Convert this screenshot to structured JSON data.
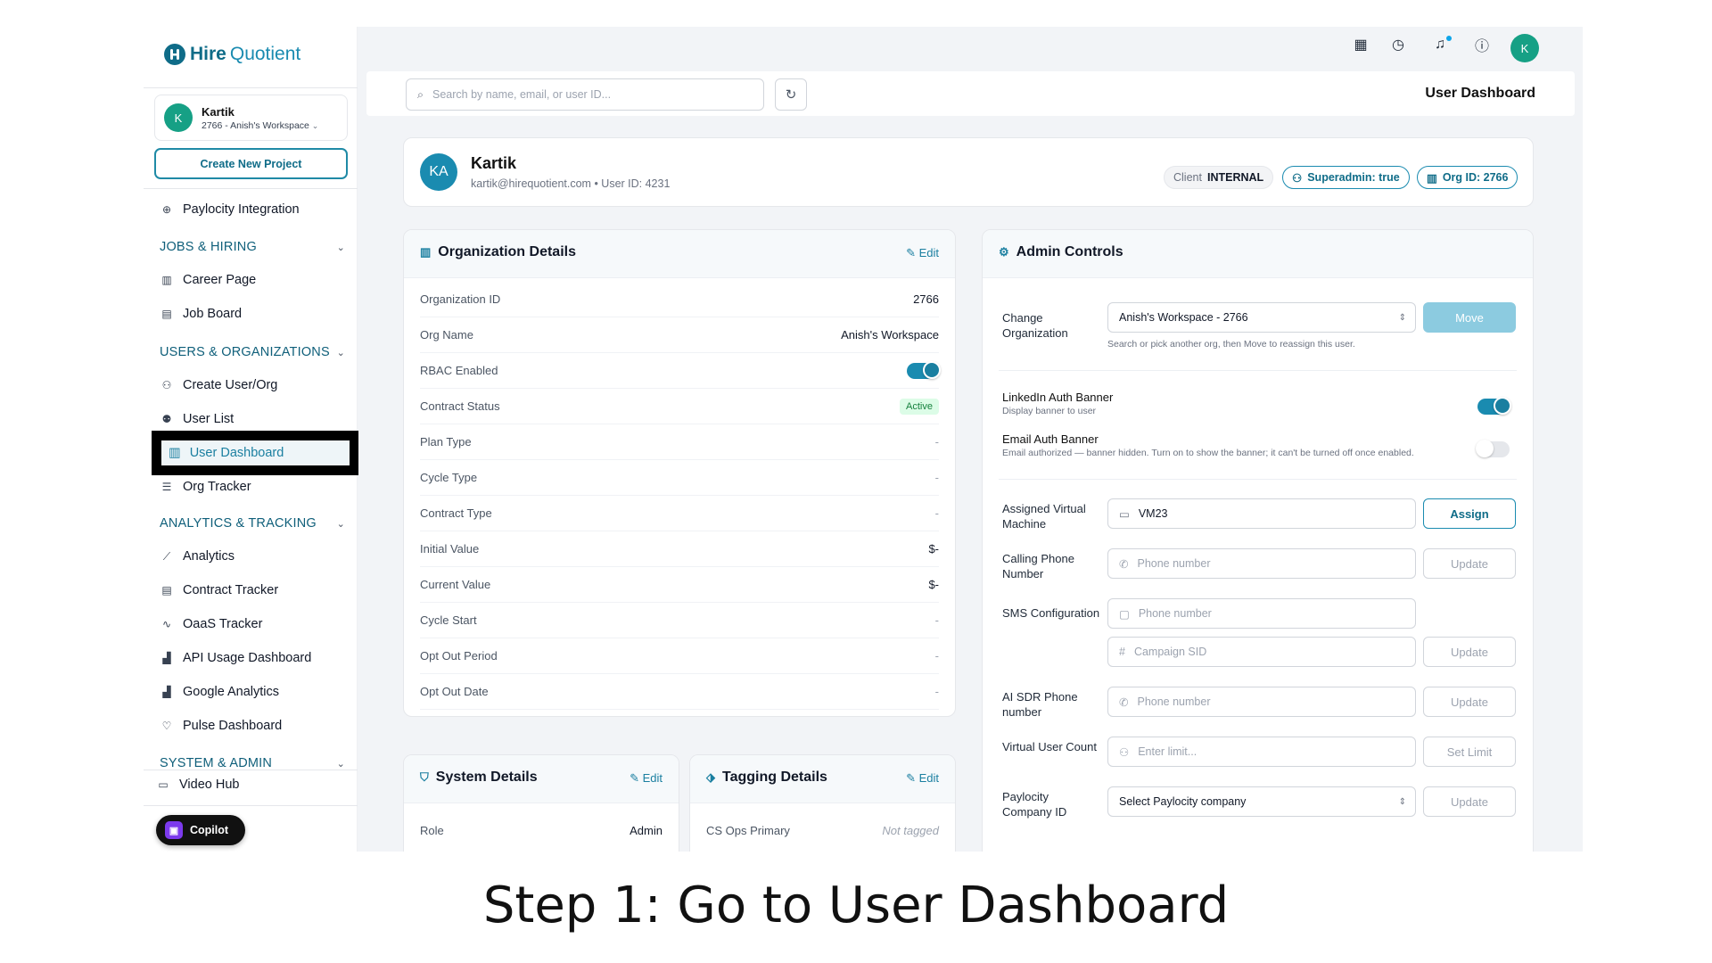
{
  "brand": {
    "name_a": "Hire",
    "name_b": "Quotient"
  },
  "account": {
    "initial": "K",
    "name": "Kartik",
    "workspace": "2766 - Anish's Workspace"
  },
  "sidebar": {
    "create_btn": "Create New Project",
    "top_item": "Paylocity Integration",
    "sections": [
      {
        "title": "JOBS & HIRING",
        "items": [
          "Career Page",
          "Job Board"
        ]
      },
      {
        "title": "USERS & ORGANIZATIONS",
        "items": [
          "Create User/Org",
          "User List",
          "User Dashboard",
          "Org Tracker"
        ]
      },
      {
        "title": "ANALYTICS & TRACKING",
        "items": [
          "Analytics",
          "Contract Tracker",
          "OaaS Tracker",
          "API Usage Dashboard",
          "Google Analytics",
          "Pulse Dashboard"
        ]
      },
      {
        "title": "SYSTEM & ADMIN",
        "items": []
      }
    ],
    "bottom_item": "Video Hub",
    "copilot": "Copilot"
  },
  "topbar": {
    "avatar": "K",
    "icons": [
      "calendar-icon",
      "calendar-clock-icon",
      "bell-icon",
      "help-icon"
    ]
  },
  "search": {
    "placeholder": "Search by name, email, or user ID..."
  },
  "page_title": "User Dashboard",
  "user": {
    "initials": "KA",
    "name": "Kartik",
    "subline": "kartik@hirequotient.com • User ID: 4231",
    "client_label": "Client",
    "client_value": "INTERNAL",
    "superadmin": "Superadmin: true",
    "org_id": "Org ID: 2766"
  },
  "org_details": {
    "title": "Organization Details",
    "edit": "Edit",
    "rows": [
      {
        "k": "Organization ID",
        "v": "2766"
      },
      {
        "k": "Org Name",
        "v": "Anish's Workspace"
      },
      {
        "k": "RBAC Enabled",
        "v": ""
      },
      {
        "k": "Contract Status",
        "v": "Active"
      },
      {
        "k": "Plan Type",
        "v": "-"
      },
      {
        "k": "Cycle Type",
        "v": "-"
      },
      {
        "k": "Contract Type",
        "v": "-"
      },
      {
        "k": "Initial Value",
        "v": "$-"
      },
      {
        "k": "Current Value",
        "v": "$-"
      },
      {
        "k": "Cycle Start",
        "v": "-"
      },
      {
        "k": "Opt Out Period",
        "v": "-"
      },
      {
        "k": "Opt Out Date",
        "v": "-"
      }
    ],
    "rbac_enabled": true
  },
  "system_details": {
    "title": "System Details",
    "edit": "Edit",
    "role_label": "Role",
    "role_value": "Admin"
  },
  "tagging_details": {
    "title": "Tagging Details",
    "edit": "Edit",
    "cs_label": "CS Ops Primary",
    "cs_value": "Not tagged"
  },
  "admin": {
    "title": "Admin Controls",
    "change_org_label": "Change Organization",
    "change_org_value": "Anish's Workspace - 2766",
    "move_btn": "Move",
    "change_org_hint": "Search or pick another org, then Move to reassign this user.",
    "linkedin_title": "LinkedIn Auth Banner",
    "linkedin_sub": "Display banner to user",
    "linkedin_on": true,
    "email_title": "Email Auth Banner",
    "email_sub": "Email authorized — banner hidden. Turn on to show the banner; it can't be turned off once enabled.",
    "email_on": false,
    "vm_label": "Assigned Virtual Machine",
    "vm_value": "VM23",
    "vm_btn": "Assign",
    "phone_label": "Calling Phone Number",
    "phone_ph": "Phone number",
    "phone_btn": "Update",
    "sms_label": "SMS Configuration",
    "sms_phone_ph": "Phone number",
    "sms_sid_ph": "Campaign SID",
    "sms_btn": "Update",
    "aisdr_label": "AI SDR Phone number",
    "aisdr_ph": "Phone number",
    "aisdr_btn": "Update",
    "vuc_label": "Virtual User Count",
    "vuc_ph": "Enter limit...",
    "vuc_btn": "Set Limit",
    "payloc_label": "Paylocity Company ID",
    "payloc_value": "Select Paylocity company",
    "payloc_btn": "Update"
  },
  "caption": "Step 1: Go to User Dashboard"
}
